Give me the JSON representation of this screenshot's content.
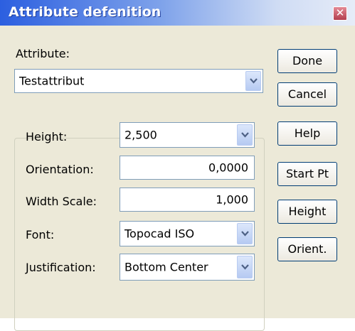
{
  "window": {
    "title": "Attribute defenition",
    "close_glyph": "✕"
  },
  "attribute": {
    "label": "Attribute:",
    "value": "Testattribut"
  },
  "fields": {
    "height": {
      "label": "Height:",
      "value": "2,500"
    },
    "orientation": {
      "label": "Orientation:",
      "value": "0,0000"
    },
    "width_scale": {
      "label": "Width Scale:",
      "value": "1,000"
    },
    "font": {
      "label": "Font:",
      "value": "Topocad ISO"
    },
    "justification": {
      "label": "Justification:",
      "value": "Bottom Center"
    }
  },
  "buttons": {
    "done": "Done",
    "cancel": "Cancel",
    "help": "Help",
    "start_pt": "Start Pt",
    "height": "Height",
    "orient": "Orient."
  },
  "colors": {
    "title_bar": "#2c5fe0",
    "dialog_bg": "#ece9d8",
    "field_border": "#7f9db9",
    "button_border": "#003c74"
  },
  "icons": {
    "dropdown": "chevron-down-icon",
    "close": "close-icon"
  }
}
